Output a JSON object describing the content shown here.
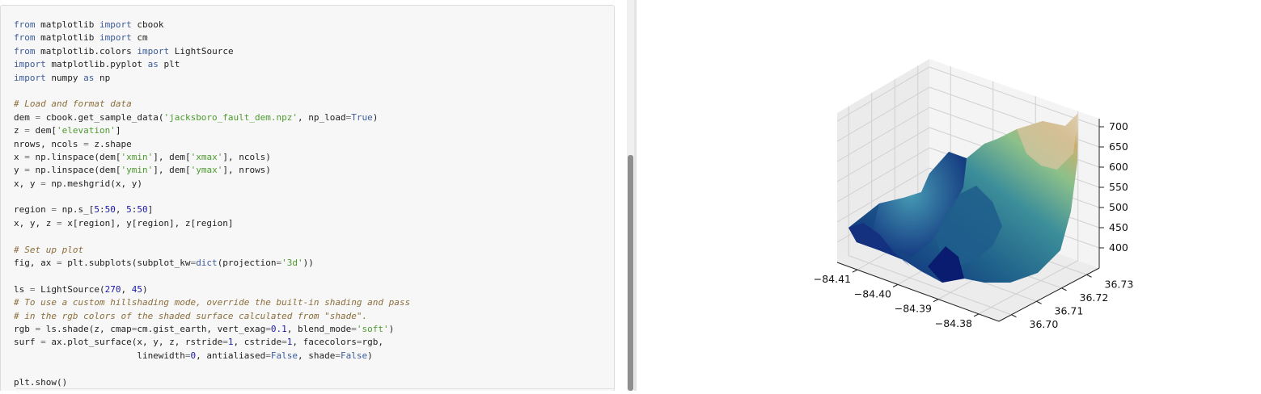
{
  "code_lines": [
    [
      {
        "t": "from",
        "c": "kw"
      },
      {
        "t": " matplotlib "
      },
      {
        "t": "import",
        "c": "kw"
      },
      {
        "t": " cbook"
      }
    ],
    [
      {
        "t": "from",
        "c": "kw"
      },
      {
        "t": " matplotlib "
      },
      {
        "t": "import",
        "c": "kw"
      },
      {
        "t": " cm"
      }
    ],
    [
      {
        "t": "from",
        "c": "kw"
      },
      {
        "t": " matplotlib.colors "
      },
      {
        "t": "import",
        "c": "kw"
      },
      {
        "t": " LightSource"
      }
    ],
    [
      {
        "t": "import",
        "c": "kw"
      },
      {
        "t": " matplotlib.pyplot "
      },
      {
        "t": "as",
        "c": "kw"
      },
      {
        "t": " plt"
      }
    ],
    [
      {
        "t": "import",
        "c": "kw"
      },
      {
        "t": " numpy "
      },
      {
        "t": "as",
        "c": "kw"
      },
      {
        "t": " np"
      }
    ],
    [],
    [
      {
        "t": "# Load and format data",
        "c": "com"
      }
    ],
    [
      {
        "t": "dem "
      },
      {
        "t": "=",
        "c": "op"
      },
      {
        "t": " cbook.get_sample_data("
      },
      {
        "t": "'jacksboro_fault_dem.npz'",
        "c": "str"
      },
      {
        "t": ", np_load"
      },
      {
        "t": "=",
        "c": "op"
      },
      {
        "t": "True",
        "c": "kw"
      },
      {
        "t": ")"
      }
    ],
    [
      {
        "t": "z "
      },
      {
        "t": "=",
        "c": "op"
      },
      {
        "t": " dem["
      },
      {
        "t": "'elevation'",
        "c": "str"
      },
      {
        "t": "]"
      }
    ],
    [
      {
        "t": "nrows, ncols "
      },
      {
        "t": "=",
        "c": "op"
      },
      {
        "t": " z.shape"
      }
    ],
    [
      {
        "t": "x "
      },
      {
        "t": "=",
        "c": "op"
      },
      {
        "t": " np.linspace(dem["
      },
      {
        "t": "'xmin'",
        "c": "str"
      },
      {
        "t": "], dem["
      },
      {
        "t": "'xmax'",
        "c": "str"
      },
      {
        "t": "], ncols)"
      }
    ],
    [
      {
        "t": "y "
      },
      {
        "t": "=",
        "c": "op"
      },
      {
        "t": " np.linspace(dem["
      },
      {
        "t": "'ymin'",
        "c": "str"
      },
      {
        "t": "], dem["
      },
      {
        "t": "'ymax'",
        "c": "str"
      },
      {
        "t": "], nrows)"
      }
    ],
    [
      {
        "t": "x, y "
      },
      {
        "t": "=",
        "c": "op"
      },
      {
        "t": " np.meshgrid(x, y)"
      }
    ],
    [],
    [
      {
        "t": "region "
      },
      {
        "t": "=",
        "c": "op"
      },
      {
        "t": " np.s_["
      },
      {
        "t": "5",
        "c": "num"
      },
      {
        "t": ":"
      },
      {
        "t": "50",
        "c": "num"
      },
      {
        "t": ", "
      },
      {
        "t": "5",
        "c": "num"
      },
      {
        "t": ":"
      },
      {
        "t": "50",
        "c": "num"
      },
      {
        "t": "]"
      }
    ],
    [
      {
        "t": "x, y, z "
      },
      {
        "t": "=",
        "c": "op"
      },
      {
        "t": " x[region], y[region], z[region]"
      }
    ],
    [],
    [
      {
        "t": "# Set up plot",
        "c": "com"
      }
    ],
    [
      {
        "t": "fig, ax "
      },
      {
        "t": "=",
        "c": "op"
      },
      {
        "t": " plt.subplots(subplot_kw"
      },
      {
        "t": "=",
        "c": "op"
      },
      {
        "t": "dict",
        "c": "kw"
      },
      {
        "t": "(projection"
      },
      {
        "t": "=",
        "c": "op"
      },
      {
        "t": "'3d'",
        "c": "str"
      },
      {
        "t": "))"
      }
    ],
    [],
    [
      {
        "t": "ls "
      },
      {
        "t": "=",
        "c": "op"
      },
      {
        "t": " LightSource("
      },
      {
        "t": "270",
        "c": "num"
      },
      {
        "t": ", "
      },
      {
        "t": "45",
        "c": "num"
      },
      {
        "t": ")"
      }
    ],
    [
      {
        "t": "# To use a custom hillshading mode, override the built-in shading and pass",
        "c": "com"
      }
    ],
    [
      {
        "t": "# in the rgb colors of the shaded surface calculated from \"shade\".",
        "c": "com"
      }
    ],
    [
      {
        "t": "rgb "
      },
      {
        "t": "=",
        "c": "op"
      },
      {
        "t": " ls.shade(z, cmap"
      },
      {
        "t": "=",
        "c": "op"
      },
      {
        "t": "cm.gist_earth, vert_exag"
      },
      {
        "t": "=",
        "c": "op"
      },
      {
        "t": "0.1",
        "c": "num"
      },
      {
        "t": ", blend_mode"
      },
      {
        "t": "=",
        "c": "op"
      },
      {
        "t": "'soft'",
        "c": "str"
      },
      {
        "t": ")"
      }
    ],
    [
      {
        "t": "surf "
      },
      {
        "t": "=",
        "c": "op"
      },
      {
        "t": " ax.plot_surface(x, y, z, rstride"
      },
      {
        "t": "=",
        "c": "op"
      },
      {
        "t": "1",
        "c": "num"
      },
      {
        "t": ", cstride"
      },
      {
        "t": "=",
        "c": "op"
      },
      {
        "t": "1",
        "c": "num"
      },
      {
        "t": ", facecolors"
      },
      {
        "t": "=",
        "c": "op"
      },
      {
        "t": "rgb,"
      }
    ],
    [
      {
        "t": "                       linewidth"
      },
      {
        "t": "=",
        "c": "op"
      },
      {
        "t": "0",
        "c": "num"
      },
      {
        "t": ", antialiased"
      },
      {
        "t": "=",
        "c": "op"
      },
      {
        "t": "False",
        "c": "kw"
      },
      {
        "t": ", shade"
      },
      {
        "t": "=",
        "c": "op"
      },
      {
        "t": "False",
        "c": "kw"
      },
      {
        "t": ")"
      }
    ],
    [],
    [
      {
        "t": "plt.show()"
      }
    ]
  ],
  "chart_data": {
    "type": "surface3d",
    "title": "",
    "xlabel": "",
    "ylabel": "",
    "zlabel": "",
    "x_ticks": [
      "−84.41",
      "−84.40",
      "−84.39",
      "−84.38"
    ],
    "y_ticks": [
      "36.70",
      "36.71",
      "36.72",
      "36.73"
    ],
    "z_ticks": [
      "400",
      "450",
      "500",
      "550",
      "600",
      "650",
      "700"
    ],
    "xlim": [
      -84.415,
      -84.375
    ],
    "ylim": [
      36.695,
      36.735
    ],
    "zlim": [
      350,
      720
    ],
    "colormap": "gist_earth",
    "grid": true
  },
  "colors": {
    "pane_left": "#ebebeb",
    "pane_right": "#f4f4f4",
    "pane_floor": "#ececec",
    "grid": "#d0d0d0"
  }
}
